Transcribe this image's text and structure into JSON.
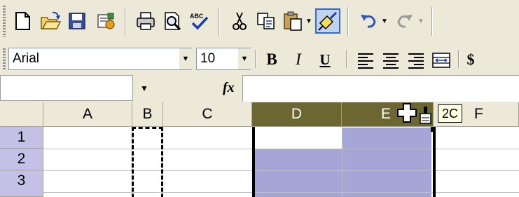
{
  "toolbar_standard": {
    "buttons": [
      {
        "name": "new-icon"
      },
      {
        "name": "open-folder-icon"
      },
      {
        "name": "save-icon"
      },
      {
        "name": "permission-icon"
      },
      {
        "name": "print-icon"
      },
      {
        "name": "print-preview-icon"
      },
      {
        "name": "spelling-icon"
      },
      {
        "name": "cut-icon"
      },
      {
        "name": "copy-icon"
      },
      {
        "name": "paste-icon"
      },
      {
        "name": "format-painter-icon"
      },
      {
        "name": "undo-icon"
      },
      {
        "name": "redo-icon"
      }
    ]
  },
  "toolbar_formatting": {
    "font_name": "Arial",
    "font_size": "10",
    "bold_label": "B",
    "italic_label": "I",
    "underline_label": "U",
    "currency_label": "$"
  },
  "formula_bar": {
    "name_box_value": "",
    "formula_value": ""
  },
  "grid": {
    "columns": [
      "A",
      "B",
      "C",
      "D",
      "E",
      "F"
    ],
    "selected_columns": [
      "D",
      "E"
    ],
    "rows": [
      "1",
      "2",
      "3"
    ]
  },
  "tooltip": {
    "text": "2C"
  },
  "colors": {
    "toolbar_bg": "#ece9d8",
    "selected_header": "#6c6632",
    "selection_fill": "#a6a6d6",
    "row_header": "#c5c0e6",
    "tooltip_bg": "#ffffe1"
  }
}
